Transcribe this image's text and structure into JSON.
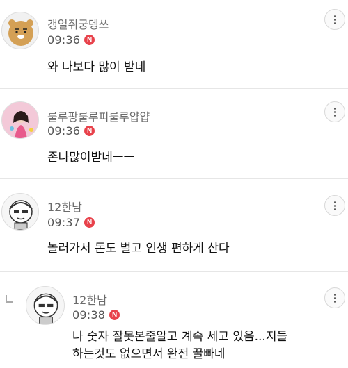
{
  "comments": [
    {
      "nickname": "갱얼쥐궁뎅쓰",
      "time": "09:36",
      "badge": "N",
      "text": "와 나보다 많이 받네",
      "avatar": "ryan-character-avatar"
    },
    {
      "nickname": "룰루팡룰루피룰루얍얍",
      "time": "09:36",
      "badge": "N",
      "text": "존나많이받네ㅡㅡ",
      "avatar": "character-photo-avatar"
    },
    {
      "nickname": "12한남",
      "time": "09:37",
      "badge": "N",
      "text": "놀러가서 돈도 벌고 인생 편하게 산다",
      "avatar": "cartoon-face-avatar"
    }
  ],
  "reply": {
    "nickname": "12한남",
    "time": "09:38",
    "badge": "N",
    "text_line1": "나 숫자 잘못본줄알고 계속 세고 있음...지들",
    "text_line2": "하는것도 없으면서 완전 꿀빠네",
    "avatar": "cartoon-face-avatar"
  },
  "colors": {
    "badge": "#e8424b",
    "nickname": "#6b6b6b",
    "divider": "#e6e6e6"
  },
  "icons": {
    "more": "more-vertical-icon",
    "reply": "reply-arrow-icon"
  }
}
